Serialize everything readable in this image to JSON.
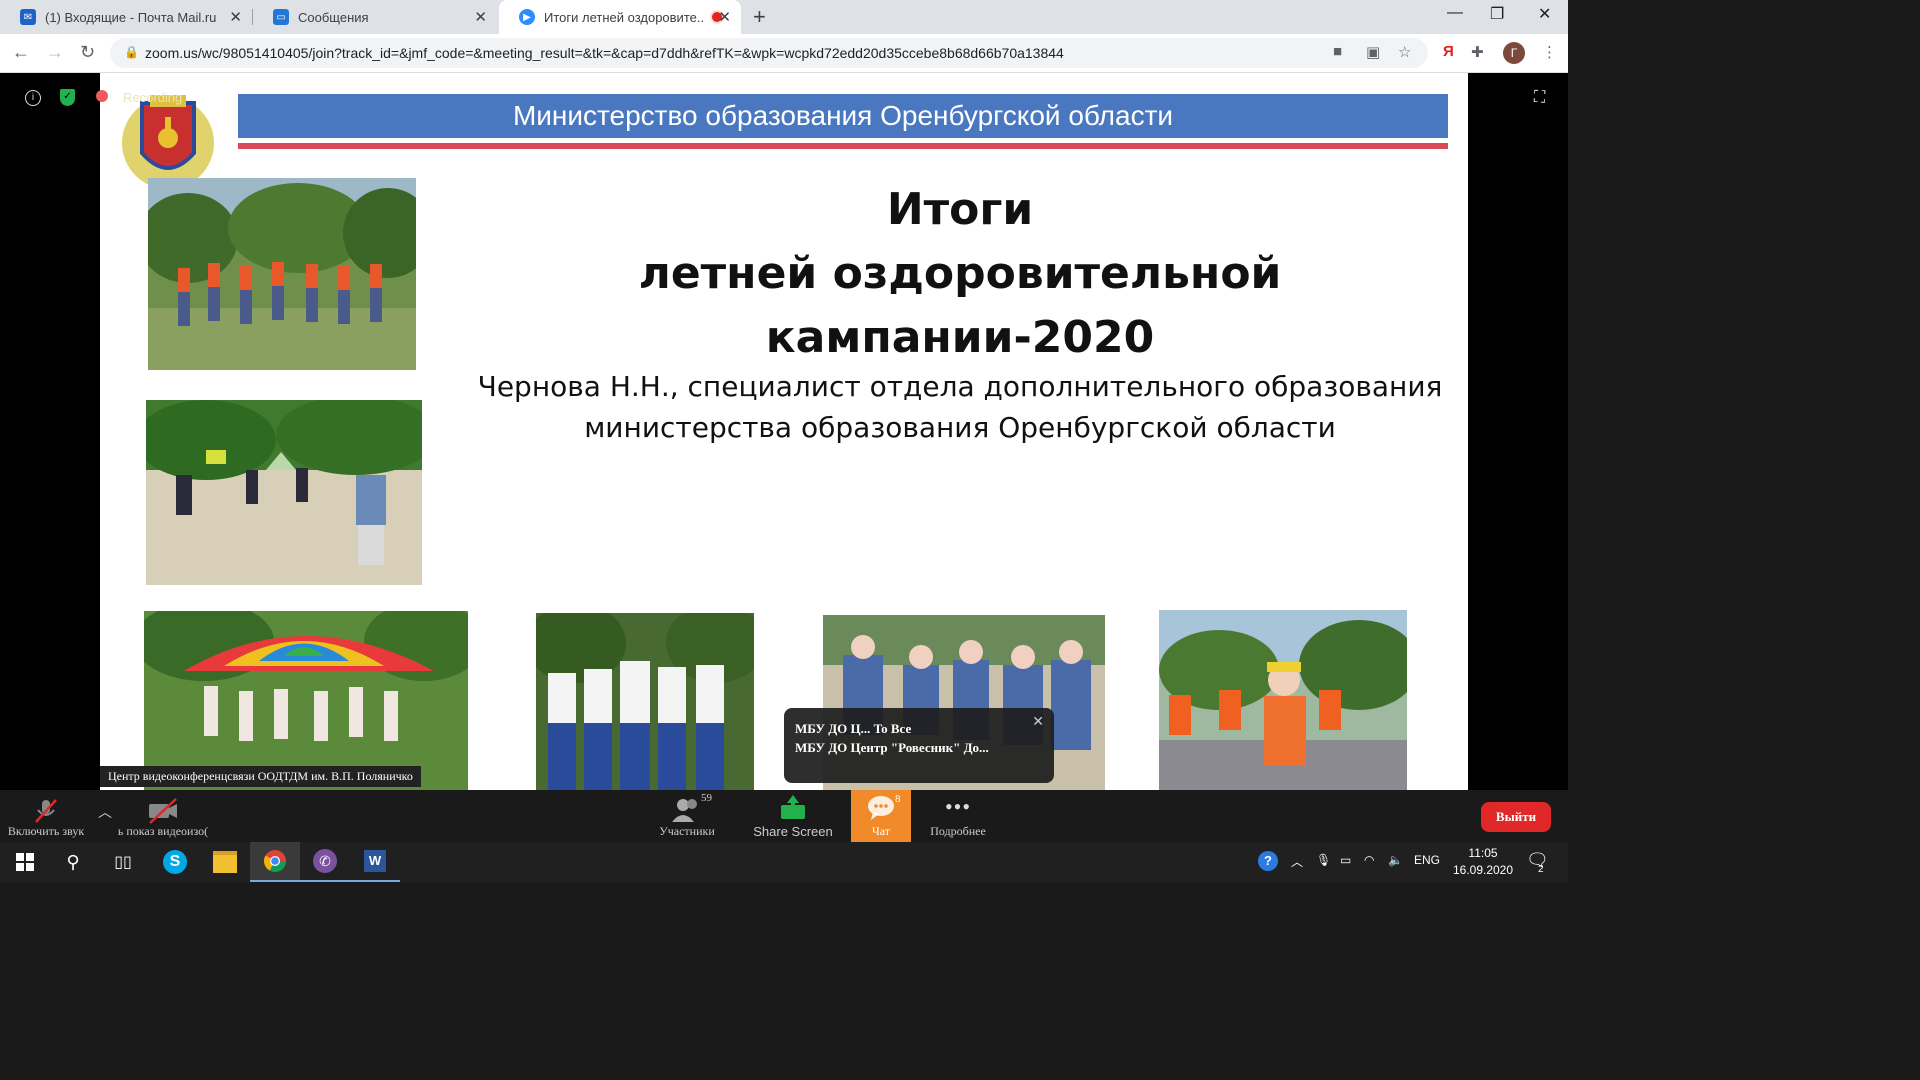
{
  "browser": {
    "tabs": [
      {
        "title": "(1) Входящие - Почта Mail.ru"
      },
      {
        "title": "Сообщения"
      },
      {
        "title": "Итоги летней оздоровите..."
      }
    ],
    "url": "zoom.us/wc/98051410405/join?track_id=&jmf_code=&meeting_result=&tk=&cap=d7ddh&refTK=&wpk=wcpkd72edd20d35ccebe8b68d66b70a13844",
    "profile_initial": "Г"
  },
  "meeting": {
    "recording_label": "Recording"
  },
  "slide": {
    "banner": "Министерство образования Оренбургской области",
    "title_line1": "Итоги",
    "title_line2": "летней оздоровительной кампании-2020",
    "author_line1": "Чернова Н.Н., специалист отдела дополнительного образования",
    "author_line2": "министерства образования Оренбургской области"
  },
  "video_caption": "Центр видеоконференцсвязи ООДТДМ им. В.П. Поляничко",
  "chat_toast": {
    "line1": "МБУ ДО Ц... To Все",
    "line2": "МБУ ДО Центр \"Ровесник\" До..."
  },
  "controls": {
    "unmute_label": "Включить звук",
    "video_label": "ь показ видеоизо(",
    "participants_label": "Участники",
    "participants_count": "59",
    "share_label": "Share Screen",
    "chat_label": "Чат",
    "chat_count": "8",
    "more_label": "Подробнее",
    "exit_label": "Выйти"
  },
  "taskbar": {
    "lang": "ENG",
    "time": "11:05",
    "date": "16.09.2020",
    "notifications": "2"
  },
  "colors": {
    "banner_blue": "#4a78c0",
    "banner_red_line": "#d94a5a",
    "chat_orange": "#f08a2a",
    "exit_red": "#e02828",
    "share_green": "#23b14d"
  }
}
